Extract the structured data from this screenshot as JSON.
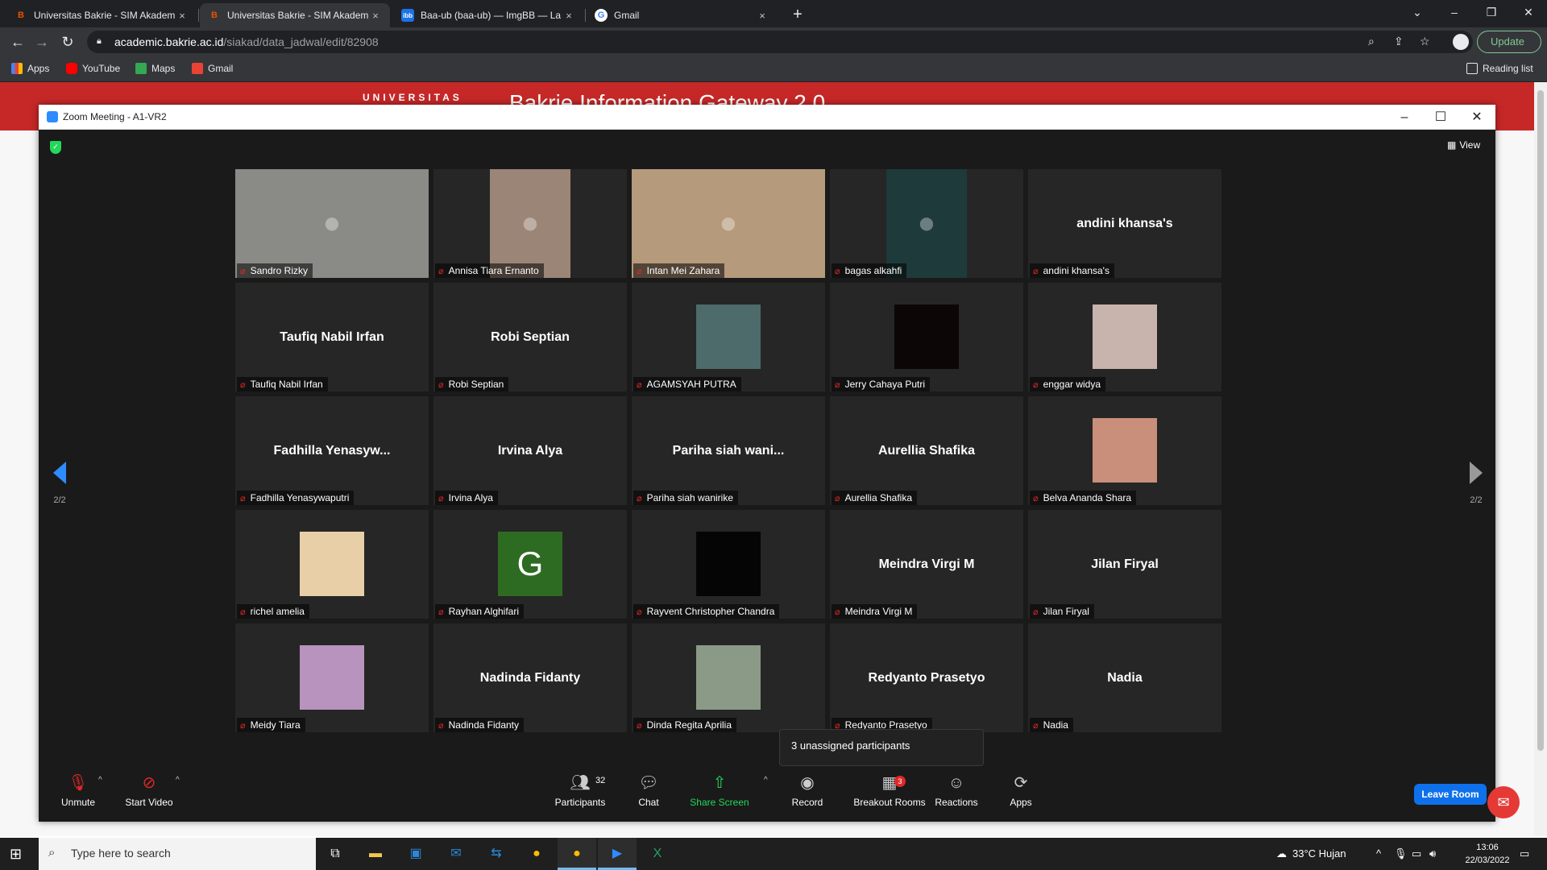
{
  "browser": {
    "tabs": [
      {
        "title": "Universitas Bakrie - SIM Akadem",
        "favicon": "B",
        "active": false
      },
      {
        "title": "Universitas Bakrie - SIM Akadem",
        "favicon": "B",
        "active": true
      },
      {
        "title": "Baa-ub (baa-ub) — ImgBB — La",
        "favicon": "ibb",
        "active": false
      },
      {
        "title": "Gmail",
        "favicon": "G",
        "active": false
      }
    ],
    "tab_close": "×",
    "new_tab": "+",
    "url_host": "academic.bakrie.ac.id",
    "url_path": "/siakad/data_jadwal/edit/82908",
    "update_label": "Update",
    "bookmarks": [
      {
        "label": "Apps",
        "icon": "apps-grid-icon",
        "color": "#4285f4"
      },
      {
        "label": "YouTube",
        "icon": "youtube-icon",
        "color": "#ff0000"
      },
      {
        "label": "Maps",
        "icon": "maps-icon",
        "color": "#34a853"
      },
      {
        "label": "Gmail",
        "icon": "gmail-icon",
        "color": "#ea4335"
      }
    ],
    "reading_list": "Reading list"
  },
  "webpage": {
    "brand": "UNIVERSITAS",
    "gateway_title": "Bakrie Information Gateway 2.0",
    "header_color": "#c62828"
  },
  "zoom": {
    "window_title": "Zoom Meeting - A1-VR2",
    "view_label": "View",
    "page_left": "2/2",
    "page_right": "2/2",
    "participants": [
      {
        "name": "Sandro Rizky",
        "display": "",
        "kind": "video",
        "color": "#8a8a86"
      },
      {
        "name": "Annisa Tiara Ernanto",
        "display": "",
        "kind": "video",
        "color": "#9b8577"
      },
      {
        "name": "Intan Mei Zahara",
        "display": "",
        "kind": "video",
        "color": "#b59a7c"
      },
      {
        "name": "bagas alkahfi",
        "display": "",
        "kind": "video",
        "color": "#1e3a3a"
      },
      {
        "name": "andini khansa's",
        "display": "andini khansa's",
        "kind": "name"
      },
      {
        "name": "Taufiq Nabil Irfan",
        "display": "Taufiq Nabil Irfan",
        "kind": "name"
      },
      {
        "name": "Robi Septian",
        "display": "Robi Septian",
        "kind": "name"
      },
      {
        "name": "AGAMSYAH PUTRA",
        "display": "",
        "kind": "photo",
        "color": "#4d6b6a"
      },
      {
        "name": "Jerry Cahaya Putri",
        "display": "",
        "kind": "photo",
        "color": "#0c0606"
      },
      {
        "name": "enggar widya",
        "display": "",
        "kind": "photo",
        "color": "#c9b3ad"
      },
      {
        "name": "Fadhilla Yenasywaputri",
        "display": "Fadhilla  Yenasyw...",
        "kind": "name"
      },
      {
        "name": "Irvina Alya",
        "display": "Irvina Alya",
        "kind": "name"
      },
      {
        "name": "Pariha siah wanirike",
        "display": "Pariha siah wani...",
        "kind": "name"
      },
      {
        "name": "Aurellia Shafika",
        "display": "Aurellia Shafika",
        "kind": "name"
      },
      {
        "name": "Belva Ananda Shara",
        "display": "",
        "kind": "photo",
        "color": "#c98f7a"
      },
      {
        "name": "richel amelia",
        "display": "",
        "kind": "photo",
        "color": "#e8cfa7"
      },
      {
        "name": "Rayhan Alghifari",
        "display": "G",
        "kind": "letter",
        "color": "#2e6b22"
      },
      {
        "name": "Rayvent Christopher Chandra",
        "display": "",
        "kind": "photo",
        "color": "#050505"
      },
      {
        "name": "Meindra Virgi M",
        "display": "Meindra Virgi M",
        "kind": "name"
      },
      {
        "name": "Jilan Firyal",
        "display": "Jilan Firyal",
        "kind": "name"
      },
      {
        "name": "Meidy Tiara",
        "display": "",
        "kind": "photo",
        "color": "#b793bd"
      },
      {
        "name": "Nadinda Fidanty",
        "display": "Nadinda Fidanty",
        "kind": "name"
      },
      {
        "name": "Dinda Regita Aprilia",
        "display": "",
        "kind": "photo",
        "color": "#8a9a86"
      },
      {
        "name": "Redyanto Prasetyo",
        "display": "Redyanto Prasetyo",
        "kind": "name"
      },
      {
        "name": "Nadia",
        "display": "Nadia",
        "kind": "name"
      }
    ],
    "tooltip": "3 unassigned participants",
    "controls": {
      "unmute": "Unmute",
      "start_video": "Start Video",
      "participants": "Participants",
      "participants_count": "32",
      "chat": "Chat",
      "share_screen": "Share Screen",
      "record": "Record",
      "breakout_rooms": "Breakout Rooms",
      "breakout_badge": "3",
      "reactions": "Reactions",
      "apps": "Apps",
      "leave_room": "Leave Room"
    },
    "colors": {
      "accent": "#2d8cff",
      "share": "#23d959",
      "leave": "#0e71eb",
      "muted": "#e02828"
    }
  },
  "taskbar": {
    "search_placeholder": "Type here to search",
    "weather": "33°C  Hujan",
    "time": "13:06",
    "date": "22/03/2022"
  }
}
